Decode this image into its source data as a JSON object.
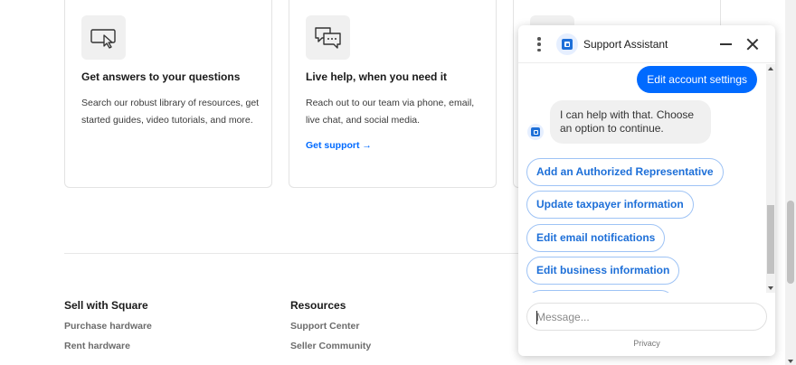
{
  "cards": [
    {
      "icon": "cursor-window-icon",
      "title": "Get answers to your questions",
      "description": "Search our robust library of resources, get started guides, video tutorials, and more."
    },
    {
      "icon": "chat-bubbles-icon",
      "title": "Live help, when you need it",
      "description": "Reach out to our team via phone, email, live chat, and social media.",
      "link": "Get support →"
    },
    {
      "icon": "card-icon"
    }
  ],
  "footer": {
    "sell": {
      "heading": "Sell with Square",
      "links": [
        "Purchase hardware",
        "Rent hardware"
      ]
    },
    "resources": {
      "heading": "Resources",
      "links": [
        "Support Center",
        "Seller Community"
      ]
    }
  },
  "chat": {
    "title": "Support Assistant",
    "user_message": "Edit account settings",
    "bot_message": "I can help with that. Choose an option to continue.",
    "options": [
      "Add an Authorized Representative",
      "Update taxpayer information",
      "Edit email notifications",
      "Edit business information",
      ""
    ],
    "input_placeholder": "Message...",
    "privacy": "Privacy"
  },
  "colors": {
    "accent": "#006aff",
    "option_text": "#1d6fd8",
    "option_border": "#9ec3f5"
  }
}
